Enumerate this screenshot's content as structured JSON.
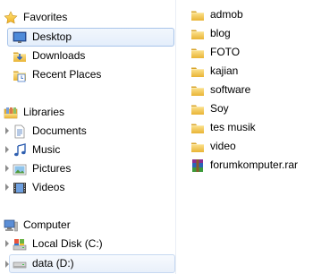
{
  "nav": {
    "favorites": {
      "label": "Favorites",
      "icon": "star-icon"
    },
    "favorites_items": [
      {
        "label": "Desktop",
        "icon": "desktop-icon"
      },
      {
        "label": "Downloads",
        "icon": "downloads-icon"
      },
      {
        "label": "Recent Places",
        "icon": "recent-places-icon"
      }
    ],
    "libraries": {
      "label": "Libraries",
      "icon": "libraries-icon"
    },
    "libraries_items": [
      {
        "label": "Documents",
        "icon": "documents-icon"
      },
      {
        "label": "Music",
        "icon": "music-icon"
      },
      {
        "label": "Pictures",
        "icon": "pictures-icon"
      },
      {
        "label": "Videos",
        "icon": "videos-icon"
      }
    ],
    "computer": {
      "label": "Computer",
      "icon": "computer-icon"
    },
    "computer_items": [
      {
        "label": "Local Disk (C:)",
        "icon": "local-disk-icon"
      },
      {
        "label": "data (D:)",
        "icon": "drive-icon"
      }
    ]
  },
  "files": [
    {
      "name": "admob",
      "icon": "folder-icon"
    },
    {
      "name": "blog",
      "icon": "folder-icon"
    },
    {
      "name": "FOTO",
      "icon": "folder-icon"
    },
    {
      "name": "kajian",
      "icon": "folder-icon"
    },
    {
      "name": "software",
      "icon": "folder-icon"
    },
    {
      "name": "Soy",
      "icon": "folder-icon"
    },
    {
      "name": "tes musik",
      "icon": "folder-icon"
    },
    {
      "name": "video",
      "icon": "folder-icon"
    },
    {
      "name": "forumkomputer.rar",
      "icon": "rar-archive-icon"
    }
  ],
  "colors": {
    "selection_border": "#a8c4ea",
    "folder": "#f3c64d",
    "caret": "#8c8c8c"
  }
}
